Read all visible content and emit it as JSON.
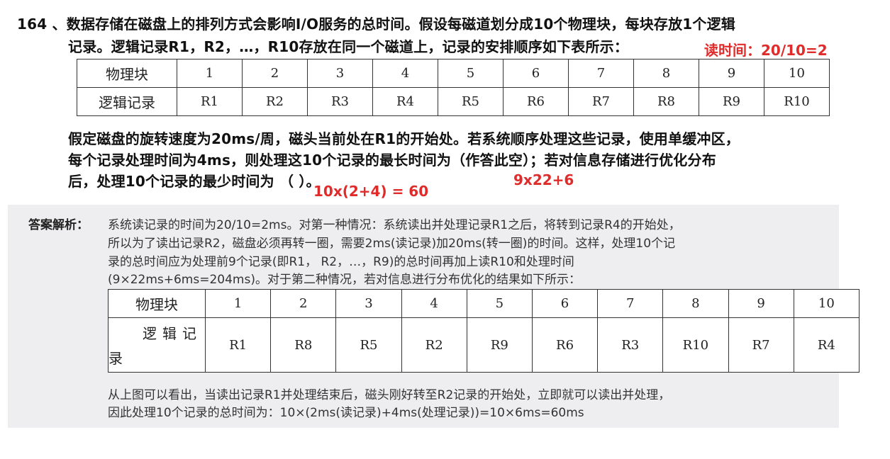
{
  "question": {
    "line1": "164 、数据存储在磁盘上的排列方式会影响I/O服务的总时间。假设每磁道划分成10个物理块，每块存放1个逻辑",
    "line2": "记录。逻辑记录R1，R2，…，R10存放在同一个磁道上，记录的安排顺序如下表所示：",
    "line3": "假定磁盘的旋转速度为20ms/周，磁头当前处在R1的开始处。若系统顺序处理这些记录，使用单缓冲区，",
    "line4": "每个记录处理时间为4ms，则处理这10个记录的最长时间为（作答此空）；若对信息存储进行优化分布",
    "line5": "后，处理10个记录的最少时间为 （ ）。"
  },
  "annotations": {
    "read_time": "读时间：20/10=2",
    "longest": "9x22+6",
    "shortest": "10x(2+4) = 60"
  },
  "table1": {
    "row_header_physical": "物理块",
    "row_header_logical": "逻辑记录",
    "physical": [
      "1",
      "2",
      "3",
      "4",
      "5",
      "6",
      "7",
      "8",
      "9",
      "10"
    ],
    "logical": [
      "R1",
      "R2",
      "R3",
      "R4",
      "R5",
      "R6",
      "R7",
      "R8",
      "R9",
      "R10"
    ]
  },
  "answer": {
    "label": "答案解析：",
    "para1": [
      "系统读记录的时间为20/10=2ms。对第一种情况：系统读出并处理记录R1之后，将转到记录R4的开始处，",
      "所以为了读出记录R2，磁盘必须再转一圈，需要2ms(读记录)加20ms(转一圈)的时间。这样，处理10个记",
      "录的总时间应为处理前9个记录(即R1， R2，…，R9)的总时间再加上读R10和处理时间",
      "(9×22ms+6ms=204ms)。对于第二种情况，若对信息进行分布优化的结果如下所示："
    ],
    "para2": [
      "从上图可以看出，当读出记录R1并处理结束后，磁头刚好转至R2记录的开始处，立即就可以读出并处理，",
      "因此处理10个记录的总时间为：10×(2ms(读记录)+4ms(处理记录))=10×6ms=60ms"
    ]
  },
  "table2": {
    "row_header_physical": "物理块",
    "row_header_logical_top": "逻辑记",
    "row_header_logical_bottom": "录",
    "physical": [
      "1",
      "2",
      "3",
      "4",
      "5",
      "6",
      "7",
      "8",
      "9",
      "10"
    ],
    "logical": [
      "R1",
      "R8",
      "R5",
      "R2",
      "R9",
      "R6",
      "R3",
      "R10",
      "R7",
      "R4"
    ]
  }
}
